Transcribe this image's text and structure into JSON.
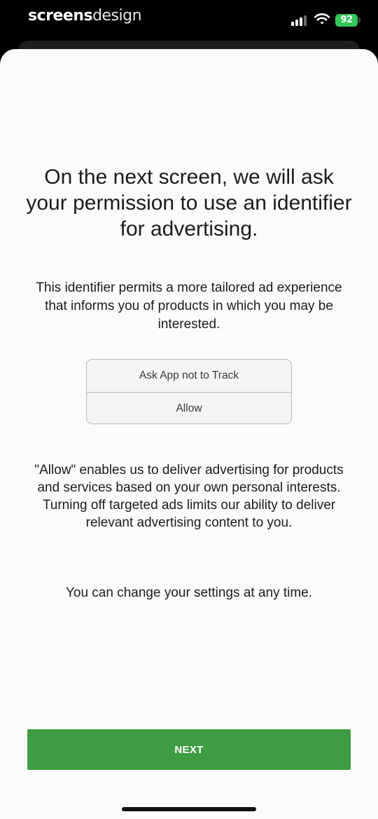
{
  "status_bar": {
    "brand_part1": "screens",
    "brand_part2": "design",
    "battery": "92",
    "signal_icon": "cellular-signal-icon",
    "wifi_icon": "wifi-icon",
    "battery_icon": "battery-charging-icon",
    "battery_color": "#34c759"
  },
  "main": {
    "headline": "On the next screen, we will ask your permission to use an identifier for advertising.",
    "intro": "This identifier permits a more tailored ad experience that informs you of products in which you may be interested.",
    "mock_prompt": {
      "option_1": "Ask App not to Track",
      "option_2": "Allow"
    },
    "explanation": "\"Allow\" enables us to deliver advertising for products and services based on your own personal interests. Turning off targeted ads limits our ability to deliver relevant advertising content to you.",
    "settings_note": "You can change your settings at any time."
  },
  "footer": {
    "next_label": "NEXT",
    "button_color": "#3e9d43"
  }
}
